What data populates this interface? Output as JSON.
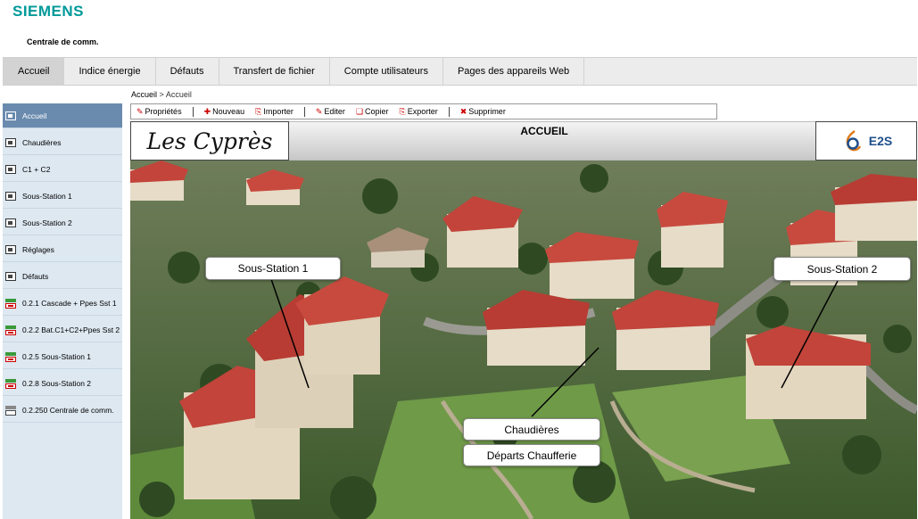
{
  "brand": {
    "logo_text": "SIEMENS",
    "app_name": "Centrale de comm."
  },
  "topnav": [
    {
      "label": "Accueil"
    },
    {
      "label": "Indice énergie"
    },
    {
      "label": "Défauts"
    },
    {
      "label": "Transfert de fichier"
    },
    {
      "label": "Compte utilisateurs"
    },
    {
      "label": "Pages des appareils Web"
    }
  ],
  "breadcrumb": {
    "root": "Accueil",
    "separator": ">",
    "current": "Accueil"
  },
  "toolbar": {
    "properties": "Propriétés",
    "new": "Nouveau",
    "import": "Importer",
    "edit": "Editer",
    "copy": "Copier",
    "export": "Exporter",
    "delete": "Supprimer"
  },
  "sidebar": [
    {
      "label": "Accueil",
      "icon": "page-icon"
    },
    {
      "label": "Chaudières",
      "icon": "page-icon"
    },
    {
      "label": "C1 + C2",
      "icon": "page-icon"
    },
    {
      "label": "Sous-Station 1",
      "icon": "page-icon"
    },
    {
      "label": "Sous-Station 2",
      "icon": "page-icon"
    },
    {
      "label": "Réglages",
      "icon": "page-icon"
    },
    {
      "label": "Défauts",
      "icon": "page-icon"
    },
    {
      "label": "0.2.1 Cascade + Ppes Sst 1",
      "icon": "device-icon"
    },
    {
      "label": "0.2.2 Bat.C1+C2+Ppes Sst 2",
      "icon": "device-icon"
    },
    {
      "label": "0.2.5 Sous-Station 1",
      "icon": "device-icon"
    },
    {
      "label": "0.2.8 Sous-Station 2",
      "icon": "device-icon"
    },
    {
      "label": "0.2.250 Centrale de comm.",
      "icon": "controller-icon"
    }
  ],
  "banner": {
    "brand_script": "Les Cyprès",
    "title": "ACCUEIL",
    "partner_logo": "E2S"
  },
  "callouts": {
    "sous_station_1": "Sous-Station 1",
    "sous_station_2": "Sous-Station 2",
    "chaudieres": "Chaudières",
    "departs": "Départs Chaufferie"
  },
  "colors": {
    "siemens": "#009999",
    "sidebar_bg": "#dde8f1",
    "sidebar_active": "#6a8bae",
    "nav_bg": "#ececec",
    "roof": "#c2443a",
    "e2s_blue": "#1f4f8a",
    "e2s_orange": "#e07a1a"
  }
}
